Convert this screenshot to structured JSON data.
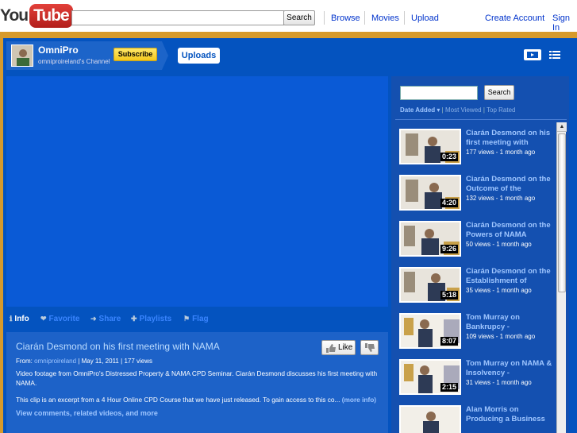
{
  "masthead": {
    "logo_you": "You",
    "logo_tube": "Tube",
    "search_button": "Search",
    "links": {
      "browse": "Browse",
      "movies": "Movies",
      "upload": "Upload",
      "create_account": "Create Account",
      "sign_in": "Sign In"
    }
  },
  "channel": {
    "name": "OmniPro",
    "subtitle": "omniproireland's Channel",
    "subscribe": "Subscribe",
    "uploads_tab": "Uploads"
  },
  "actions": {
    "info": "Info",
    "favorite": "Favorite",
    "share": "Share",
    "playlists": "Playlists",
    "flag": "Flag"
  },
  "video": {
    "title": "Ciarán Desmond on his first meeting with NAMA",
    "like": "Like",
    "from_label": "From:",
    "from_user": "omniproireland",
    "date": "May 11, 2011",
    "views": "177 views",
    "description": "Video footage from OmniPro's Distressed Property & NAMA CPD Seminar. Ciarán Desmond discusses his first meeting with NAMA.",
    "excerpt": "This clip is an excerpt from a 4 Hour Online CPD Course that we have just released. To gain access to this co...",
    "more_info": "(more info)",
    "view_comments": "View comments, related videos, and more"
  },
  "sidebar": {
    "search_button": "Search",
    "sort_selected": "Date Added",
    "sort_most_viewed": "Most Viewed",
    "sort_top_rated": "Top Rated",
    "items": [
      {
        "title": "Ciarán Desmond on his first meeting with",
        "meta": "177 views - 1 month ago",
        "duration": "0:23"
      },
      {
        "title": "Ciarán Desmond on the Outcome of the",
        "meta": "132 views - 1 month ago",
        "duration": "4:20"
      },
      {
        "title": "Ciarán Desmond on the Powers of NAMA",
        "meta": "50 views - 1 month ago",
        "duration": "9:26"
      },
      {
        "title": "Ciarán Desmond on the Establishment of",
        "meta": "35 views - 1 month ago",
        "duration": "5:18"
      },
      {
        "title": "Tom Murray on Bankrupcy -",
        "meta": "109 views - 1 month ago",
        "duration": "8:07"
      },
      {
        "title": "Tom Murray on NAMA & Insolvency -",
        "meta": "31 views - 1 month ago",
        "duration": "2:15"
      },
      {
        "title": "Alan Morris on Producing a Business",
        "meta": "",
        "duration": ""
      }
    ]
  }
}
